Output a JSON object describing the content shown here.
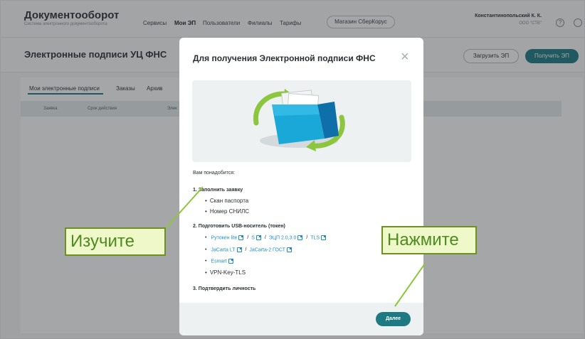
{
  "app": {
    "name": "Документооборот",
    "subtitle": "Система электронного документооборота"
  },
  "nav": [
    "Сервисы",
    "Мои ЭП",
    "Пользователи",
    "Филиалы",
    "Тарифы"
  ],
  "shop_button": "Магазин СберКорус",
  "user": {
    "name": "Константинопольский К. К.",
    "org": "ООО \"СТВ\""
  },
  "icons": {
    "help": "question-circle-icon",
    "settings": "settings-icon",
    "close": "close-icon",
    "external": "external-link-icon"
  },
  "page": {
    "title": "Электронные подписи УЦ ФНС",
    "upload_button": "Загрузить ЭП",
    "get_button": "Получить ЭП"
  },
  "tabs": [
    "Мои электронные подписи",
    "Заказы",
    "Архив"
  ],
  "table_headers": [
    "Заявка",
    "Срок действия",
    "Элек"
  ],
  "modal": {
    "title": "Для получения Электронной подписи ФНС",
    "close_label": "×",
    "need_label": "Вам понадобится:",
    "steps": [
      {
        "title": "1.  Заполнить заявку",
        "items": [
          "Скан паспорта",
          "Номер СНИЛС"
        ]
      },
      {
        "title": "2.  Подготовить USB-носитель (токен)",
        "links": [
          [
            "Рутокен lite",
            "S",
            "ЭЦП 2.0,3.0",
            "TLS"
          ],
          [
            "JaCarta LT",
            "JaCarta-2 ГОСТ"
          ],
          [
            "Esmart"
          ]
        ],
        "plain_item": "VPN-Key-TLS"
      },
      {
        "title": "3.  Подтвердить личность"
      }
    ],
    "next_button": "Далее"
  },
  "annotations": {
    "study": "Изучите",
    "click": "Нажмите"
  },
  "colors": {
    "accent": "#1d7a83",
    "link": "#1d8ec9",
    "callout_bg": "#eef8c8",
    "callout_border": "#6f8f25"
  }
}
